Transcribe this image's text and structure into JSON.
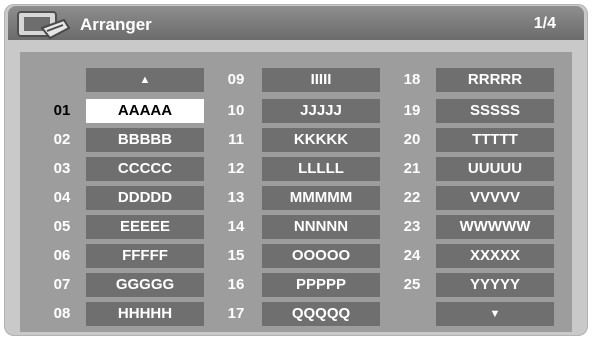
{
  "app": {
    "title": "Arranger",
    "page": "1/4"
  },
  "arrows": {
    "up": "▲",
    "down": "▼"
  },
  "columns": [
    [
      {
        "num": "01",
        "label": "AAAAA",
        "selected": true
      },
      {
        "num": "02",
        "label": "BBBBB"
      },
      {
        "num": "03",
        "label": "CCCCC"
      },
      {
        "num": "04",
        "label": "DDDDD"
      },
      {
        "num": "05",
        "label": "EEEEE"
      },
      {
        "num": "06",
        "label": "FFFFF"
      },
      {
        "num": "07",
        "label": "GGGGG"
      },
      {
        "num": "08",
        "label": "HHHHH"
      }
    ],
    [
      {
        "num": "09",
        "label": "IIIII"
      },
      {
        "num": "10",
        "label": "JJJJJ"
      },
      {
        "num": "11",
        "label": "KKKKK"
      },
      {
        "num": "12",
        "label": "LLLLL"
      },
      {
        "num": "13",
        "label": "MMMMM"
      },
      {
        "num": "14",
        "label": "NNNNN"
      },
      {
        "num": "15",
        "label": "OOOOO"
      },
      {
        "num": "16",
        "label": "PPPPP"
      },
      {
        "num": "17",
        "label": "QQQQQ"
      }
    ],
    [
      {
        "num": "18",
        "label": "RRRRR"
      },
      {
        "num": "19",
        "label": "SSSSS"
      },
      {
        "num": "20",
        "label": "TTTTT"
      },
      {
        "num": "21",
        "label": "UUUUU"
      },
      {
        "num": "22",
        "label": "VVVVV"
      },
      {
        "num": "23",
        "label": "WWWWW"
      },
      {
        "num": "24",
        "label": "XXXXX"
      },
      {
        "num": "25",
        "label": "YYYYY"
      }
    ]
  ],
  "colors": {
    "frame": "#c9c9c9",
    "titlebar": "#7a7a7a",
    "panel": "#9d9d9d",
    "cell": "#6f6f6f",
    "selected_cell": "#ffffff"
  }
}
